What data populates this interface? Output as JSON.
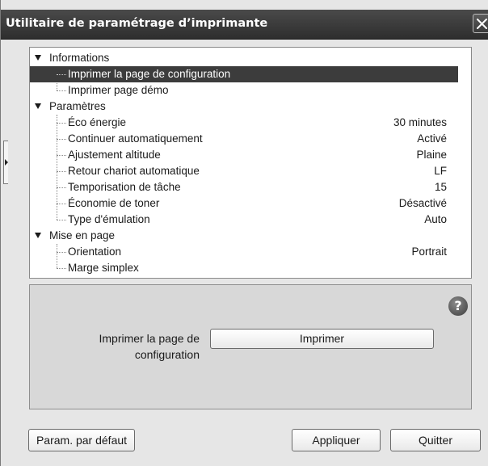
{
  "window": {
    "title": "Utilitaire de paramétrage d’imprimante",
    "close_icon": "close-icon"
  },
  "tree": {
    "categories": [
      {
        "label": "Informations",
        "items": [
          {
            "label": "Imprimer la page de configuration",
            "value": "",
            "selected": true
          },
          {
            "label": "Imprimer page démo",
            "value": ""
          }
        ]
      },
      {
        "label": "Paramètres",
        "items": [
          {
            "label": "Éco énergie",
            "value": "30 minutes"
          },
          {
            "label": "Continuer automatiquement",
            "value": "Activé"
          },
          {
            "label": "Ajustement altitude",
            "value": "Plaine"
          },
          {
            "label": "Retour chariot automatique",
            "value": "LF"
          },
          {
            "label": "Temporisation de tâche",
            "value": "15"
          },
          {
            "label": "Économie de toner",
            "value": "Désactivé"
          },
          {
            "label": "Type d'émulation",
            "value": "Auto"
          }
        ]
      },
      {
        "label": "Mise en page",
        "items": [
          {
            "label": "Orientation",
            "value": "Portrait"
          },
          {
            "label": "Marge simplex",
            "value": ""
          }
        ]
      }
    ]
  },
  "detail": {
    "action_label": "Imprimer la page de configuration",
    "print_button": "Imprimer",
    "help_icon": "help-icon",
    "help_glyph": "?"
  },
  "footer": {
    "default_button": "Param. par défaut",
    "apply_button": "Appliquer",
    "quit_button": "Quitter"
  }
}
